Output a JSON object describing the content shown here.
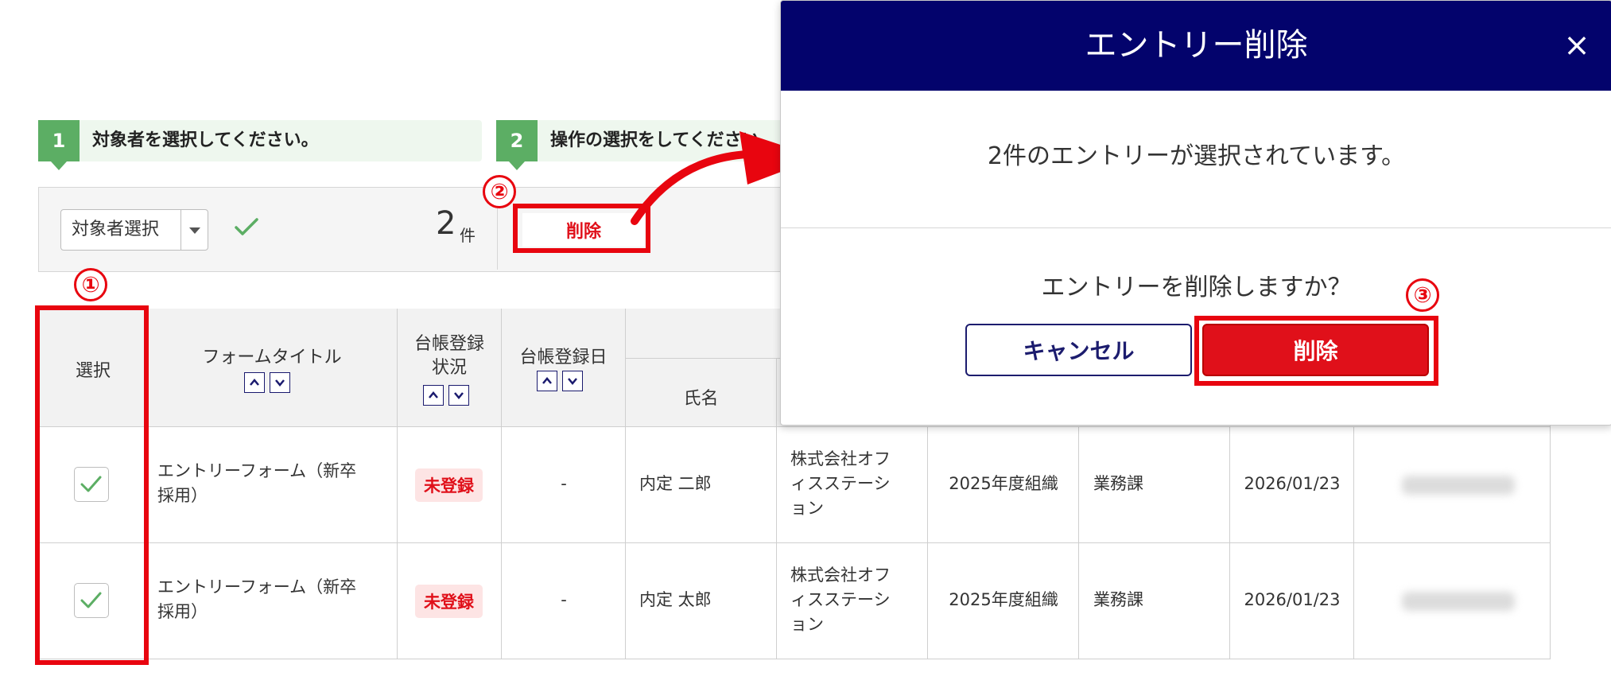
{
  "steps": [
    {
      "num": "1",
      "label": "対象者を選択してください。"
    },
    {
      "num": "2",
      "label": "操作の選択をしてください"
    }
  ],
  "panel": {
    "select_label": "対象者選択",
    "count": "2",
    "count_unit": "件",
    "delete_label": "削除"
  },
  "annotations": {
    "one": "①",
    "two": "②",
    "three": "③"
  },
  "table": {
    "headers": {
      "select": "選択",
      "form_title": "フォームタイトル",
      "ledger_status_1": "台帳登録",
      "ledger_status_2": "状況",
      "ledger_date": "台帳登録日",
      "name": "氏名"
    },
    "rows": [
      {
        "form_title_1": "エントリーフォーム（新卒",
        "form_title_2": "採用）",
        "status": "未登録",
        "date": "-",
        "name": "内定 二郎",
        "company_1": "株式会社オフ",
        "company_2": "ィスステーシ",
        "company_3": "ョン",
        "org": "2025年度組織",
        "dept": "業務課",
        "reg_date": "2026/01/23"
      },
      {
        "form_title_1": "エントリーフォーム（新卒",
        "form_title_2": "採用）",
        "status": "未登録",
        "date": "-",
        "name": "内定 太郎",
        "company_1": "株式会社オフ",
        "company_2": "ィスステーシ",
        "company_3": "ョン",
        "org": "2025年度組織",
        "dept": "業務課",
        "reg_date": "2026/01/23"
      }
    ]
  },
  "modal": {
    "title": "エントリー削除",
    "close": "×",
    "message": "2件のエントリーが選択されています。",
    "question": "エントリーを削除しますか？",
    "cancel_label": "キャンセル",
    "delete_label": "削除"
  },
  "colors": {
    "step_green": "#5cae64",
    "modal_header": "#03036c",
    "danger_red": "#e0101a",
    "annotation_red": "#e8050f"
  }
}
